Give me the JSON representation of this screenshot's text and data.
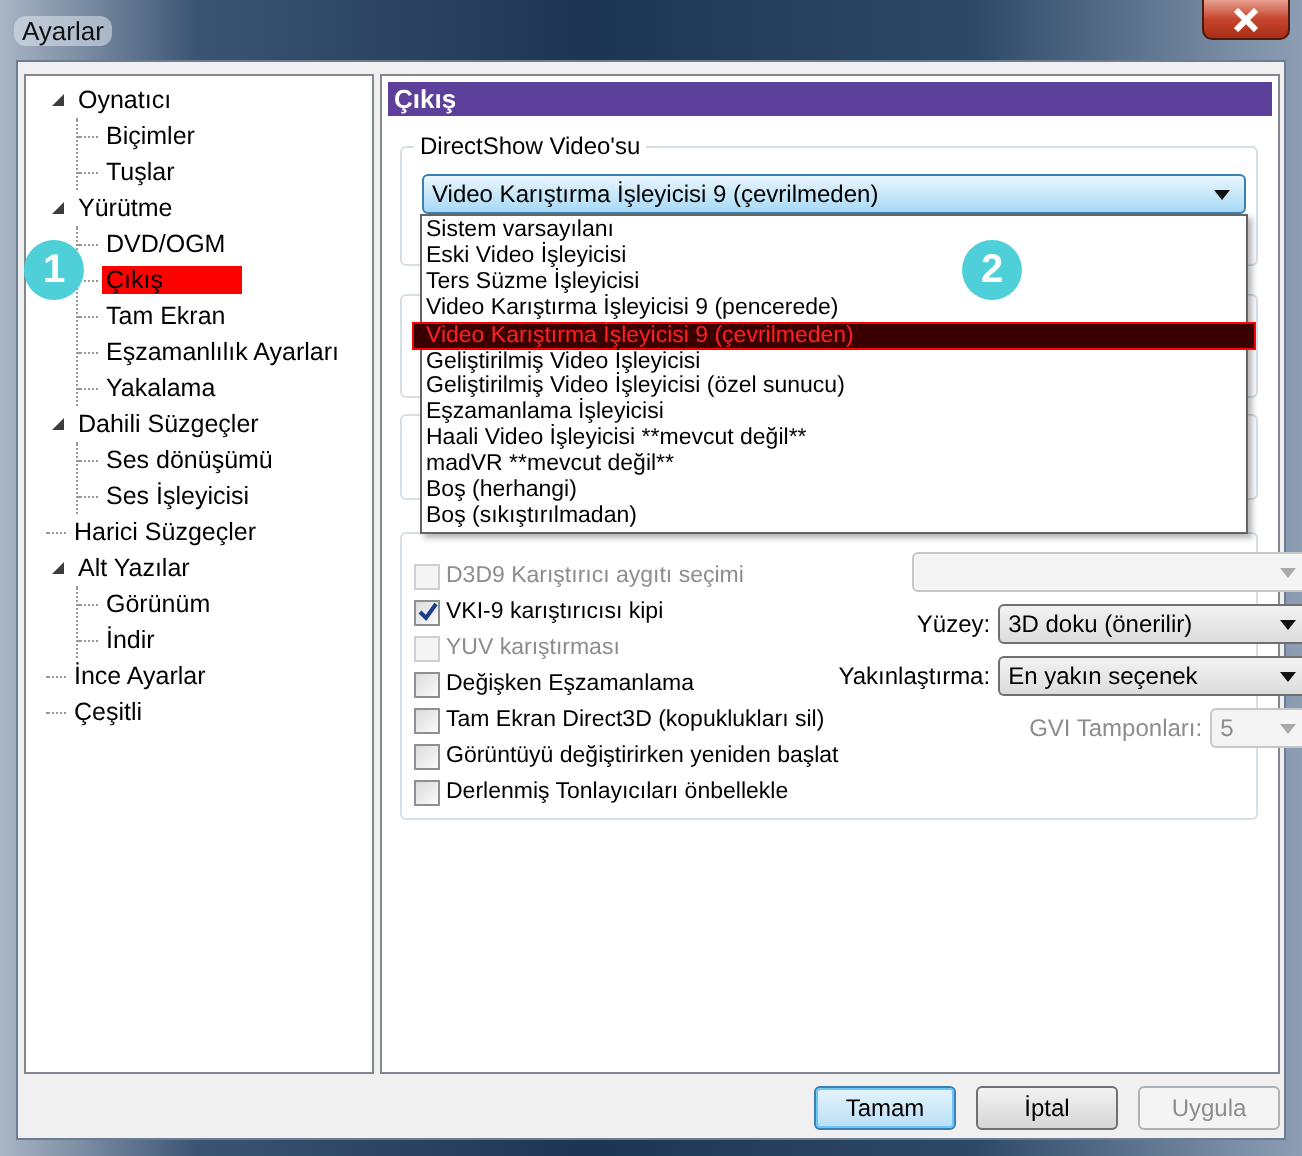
{
  "window": {
    "title": "Ayarlar"
  },
  "tree": [
    {
      "label": "Oynatıcı",
      "expanded": true,
      "selected": false,
      "children": [
        {
          "label": "Biçimler",
          "selected": false
        },
        {
          "label": "Tuşlar",
          "selected": false
        }
      ]
    },
    {
      "label": "Yürütme",
      "expanded": true,
      "selected": false,
      "children": [
        {
          "label": "DVD/OGM",
          "selected": false
        },
        {
          "label": "Çıkış",
          "selected": true
        },
        {
          "label": "Tam Ekran",
          "selected": false
        },
        {
          "label": "Eşzamanlılık Ayarları",
          "selected": false
        },
        {
          "label": "Yakalama",
          "selected": false
        }
      ]
    },
    {
      "label": "Dahili Süzgeçler",
      "expanded": true,
      "selected": false,
      "children": [
        {
          "label": "Ses dönüşümü",
          "selected": false
        },
        {
          "label": "Ses İşleyicisi",
          "selected": false
        }
      ]
    },
    {
      "label": "Harici Süzgeçler",
      "selected": false
    },
    {
      "label": "Alt Yazılar",
      "expanded": true,
      "selected": false,
      "children": [
        {
          "label": "Görünüm",
          "selected": false
        },
        {
          "label": "İndir",
          "selected": false
        }
      ]
    },
    {
      "label": "İnce Ayarlar",
      "selected": false
    },
    {
      "label": "Çeşitli",
      "selected": false
    }
  ],
  "annotations": [
    {
      "label": "1"
    },
    {
      "label": "2"
    }
  ],
  "page": {
    "title": "Çıkış"
  },
  "directshow": {
    "label": "DirectShow Video'su",
    "value": "Video Karıştırma İşleyicisi 9 (çevrilmeden)",
    "expanded": true,
    "options": [
      {
        "label": "Sistem varsayılanı",
        "selected": false
      },
      {
        "label": "Eski Video İşleyicisi",
        "selected": false
      },
      {
        "label": "Ters Süzme İşleyicisi",
        "selected": false
      },
      {
        "label": "Video Karıştırma İşleyicisi 9 (pencerede)",
        "selected": false
      },
      {
        "label": "Video Karıştırma İşleyicisi 9 (çevrilmeden)",
        "selected": true
      },
      {
        "label": "Geliştirilmiş Video İşleyicisi",
        "selected": false
      },
      {
        "label": "Geliştirilmiş Video İşleyicisi (özel sunucu)",
        "selected": false
      },
      {
        "label": "Eşzamanlama İşleyicisi",
        "selected": false
      },
      {
        "label": "Haali Video İşleyicisi **mevcut değil**",
        "selected": false
      },
      {
        "label": "madVR **mevcut değil**",
        "selected": false
      },
      {
        "label": "Boş (herhangi)",
        "selected": false
      },
      {
        "label": "Boş (sıkıştırılmadan)",
        "selected": false
      }
    ]
  },
  "settings": {
    "checkboxes": [
      {
        "label": "D3D9 Karıştırıcı aygıtı seçimi",
        "checked": false,
        "disabled": true
      },
      {
        "label": "VKI-9 karıştırıcısı kipi",
        "checked": true,
        "disabled": false
      },
      {
        "label": "YUV karıştırması",
        "checked": false,
        "disabled": true
      },
      {
        "label": "Değişken Eşzamanlama",
        "checked": false,
        "disabled": false
      },
      {
        "label": "Tam Ekran Direct3D (kopuklukları sil)",
        "checked": false,
        "disabled": false
      },
      {
        "label": "Görüntüyü değiştirirken yeniden başlat",
        "checked": false,
        "disabled": false
      },
      {
        "label": "Derlenmiş Tonlayıcıları önbellekle",
        "checked": false,
        "disabled": false
      }
    ],
    "device_select": {
      "disabled": true
    },
    "fields": [
      {
        "label": "Yüzey:",
        "value": "3D doku (önerilir)",
        "disabled": false
      },
      {
        "label": "Yakınlaştırma:",
        "value": "En yakın seçenek",
        "disabled": false
      },
      {
        "label": "GVI Tamponları:",
        "value": "5",
        "disabled": true
      }
    ]
  },
  "buttons": [
    {
      "label": "Tamam",
      "default": true,
      "disabled": false
    },
    {
      "label": "İptal",
      "default": false,
      "disabled": false
    },
    {
      "label": "Uygula",
      "default": false,
      "disabled": true
    }
  ]
}
